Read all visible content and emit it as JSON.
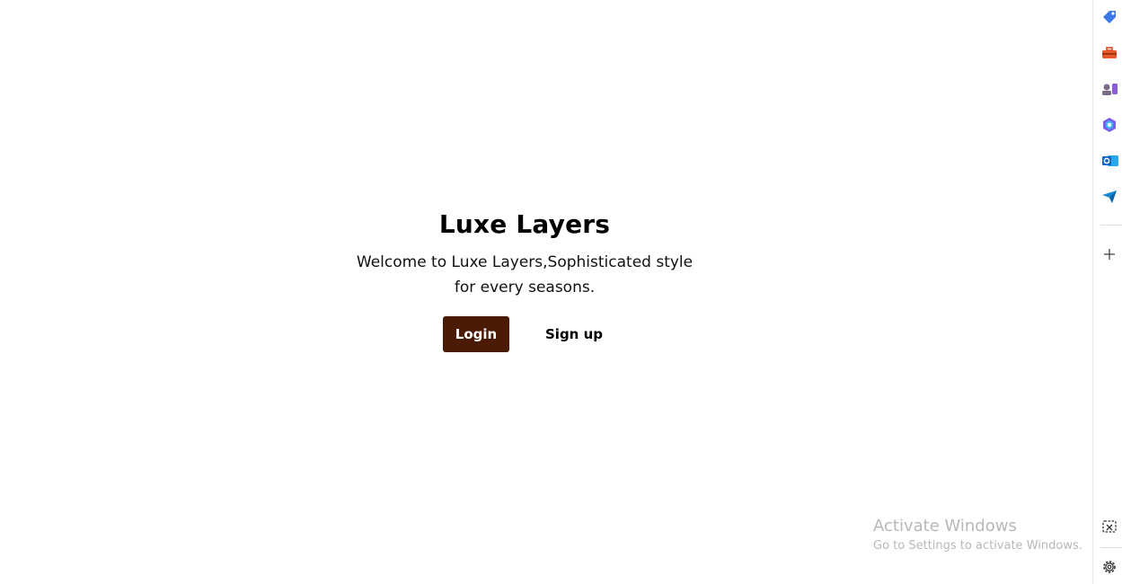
{
  "hero": {
    "title": "Luxe Layers",
    "tagline": "Welcome to Luxe Layers,Sophisticated style for every seasons.",
    "login_label": "Login",
    "signup_label": "Sign up"
  },
  "colors": {
    "login_button_bg": "#4a1a04",
    "text": "#000000",
    "watermark": "#b8b8b8"
  },
  "watermark": {
    "title": "Activate Windows",
    "subtitle": "Go to Settings to activate Windows."
  },
  "sidebar": {
    "icons": [
      "tag-icon",
      "toolbox-icon",
      "games-icon",
      "copilot-icon",
      "outlook-icon",
      "send-icon",
      "add-icon",
      "screenshot-icon",
      "settings-icon"
    ]
  }
}
